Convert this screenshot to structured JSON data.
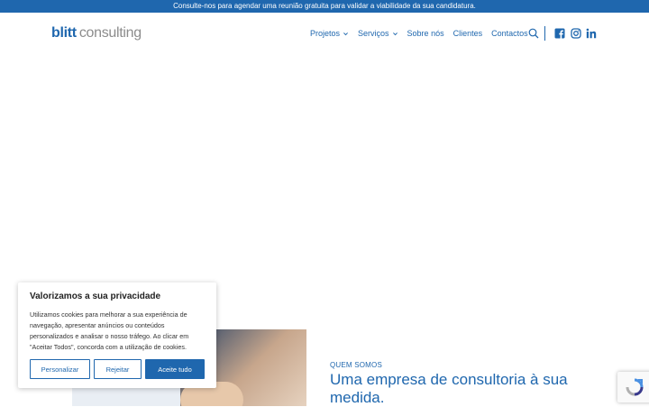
{
  "topbar": {
    "text": "Consulte-nos para agendar uma reunião gratuita para validar a viabilidade da sua candidatura."
  },
  "logo": {
    "brand": "blitt",
    "suffix": "consulting"
  },
  "nav": [
    {
      "label": "Projetos",
      "has_dropdown": true
    },
    {
      "label": "Serviços",
      "has_dropdown": true
    },
    {
      "label": "Sobre nós",
      "has_dropdown": false
    },
    {
      "label": "Clientes",
      "has_dropdown": false
    },
    {
      "label": "Contactos",
      "has_dropdown": false
    }
  ],
  "header_icons": [
    "search-icon",
    "facebook-icon",
    "instagram-icon",
    "linkedin-icon"
  ],
  "about": {
    "kicker": "QUEM SOMOS",
    "title": "Uma empresa de consultoria à sua medida."
  },
  "cookie": {
    "title": "Valorizamos a sua privacidade",
    "body": "Utilizamos cookies para melhorar a sua experiência de navegação, apresentar anúncios ou conteúdos personalizados e analisar o nosso tráfego. Ao clicar em \"Aceitar Todos\", concorda com a utilização de cookies.",
    "customize_label": "Personalizar",
    "reject_label": "Rejeitar",
    "accept_label": "Aceite tudo"
  },
  "colors": {
    "brand": "#1f67ae",
    "logo_grey": "#8c8c8c"
  }
}
